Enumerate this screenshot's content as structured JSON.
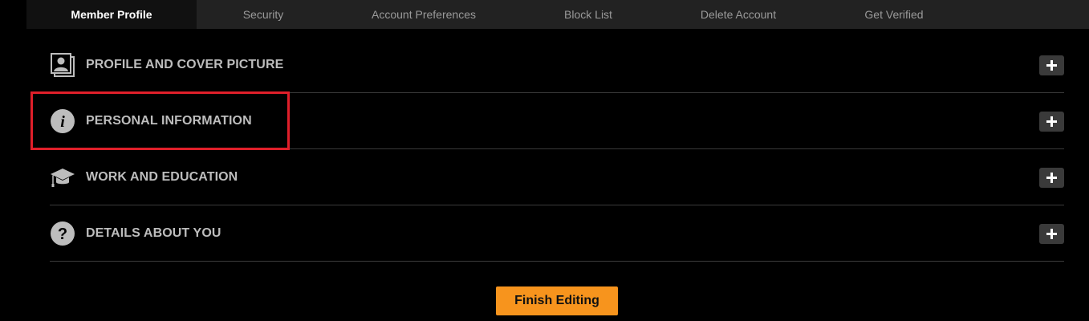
{
  "tabs": [
    {
      "label": "Member Profile",
      "active": true
    },
    {
      "label": "Security",
      "active": false
    },
    {
      "label": "Account Preferences",
      "active": false
    },
    {
      "label": "Block List",
      "active": false
    },
    {
      "label": "Delete Account",
      "active": false
    },
    {
      "label": "Get Verified",
      "active": false
    }
  ],
  "sections": [
    {
      "label": "PROFILE AND COVER PICTURE",
      "icon": "profile-picture-icon",
      "expand_icon": "plus-icon"
    },
    {
      "label": "PERSONAL INFORMATION",
      "icon": "info-icon",
      "expand_icon": "plus-icon"
    },
    {
      "label": "WORK AND EDUCATION",
      "icon": "graduation-cap-icon",
      "expand_icon": "plus-icon"
    },
    {
      "label": "DETAILS ABOUT YOU",
      "icon": "question-icon",
      "expand_icon": "plus-icon"
    }
  ],
  "finish_button": {
    "label": "Finish Editing"
  },
  "colors": {
    "background": "#000000",
    "tabbar": "#222222",
    "accent": "#f7941d",
    "highlight": "#e01f2a",
    "section_label": "#bdbdbd"
  }
}
